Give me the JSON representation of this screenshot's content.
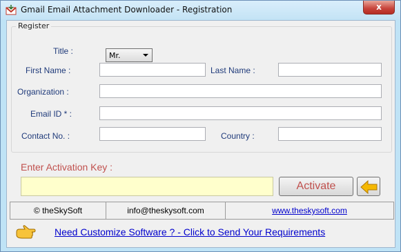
{
  "window": {
    "title": "Gmail Email Attachment Downloader - Registration",
    "close_label": "x"
  },
  "register": {
    "group_label": "Register",
    "title_label": "Title :",
    "title_value": "Mr.",
    "first_name_label": "First Name :",
    "first_name_value": "",
    "last_name_label": "Last Name :",
    "last_name_value": "",
    "organization_label": "Organization :",
    "organization_value": "",
    "email_label": "Email ID * :",
    "email_value": "",
    "contact_label": "Contact No. :",
    "contact_value": "",
    "country_label": "Country :",
    "country_value": ""
  },
  "activation": {
    "label": "Enter Activation Key  :",
    "key_value": "",
    "activate_button": "Activate"
  },
  "footer": {
    "copyright": "© theSkySoft",
    "email": "info@theskysoft.com",
    "website": "www.theskysoft.com",
    "customize_link": "Need Customize Software ? - Click to Send Your Requirements"
  },
  "colors": {
    "label_blue": "#1f3a7a",
    "accent_red": "#c0504d",
    "link_blue": "#0000cc",
    "key_field_bg": "#ffffcc"
  }
}
